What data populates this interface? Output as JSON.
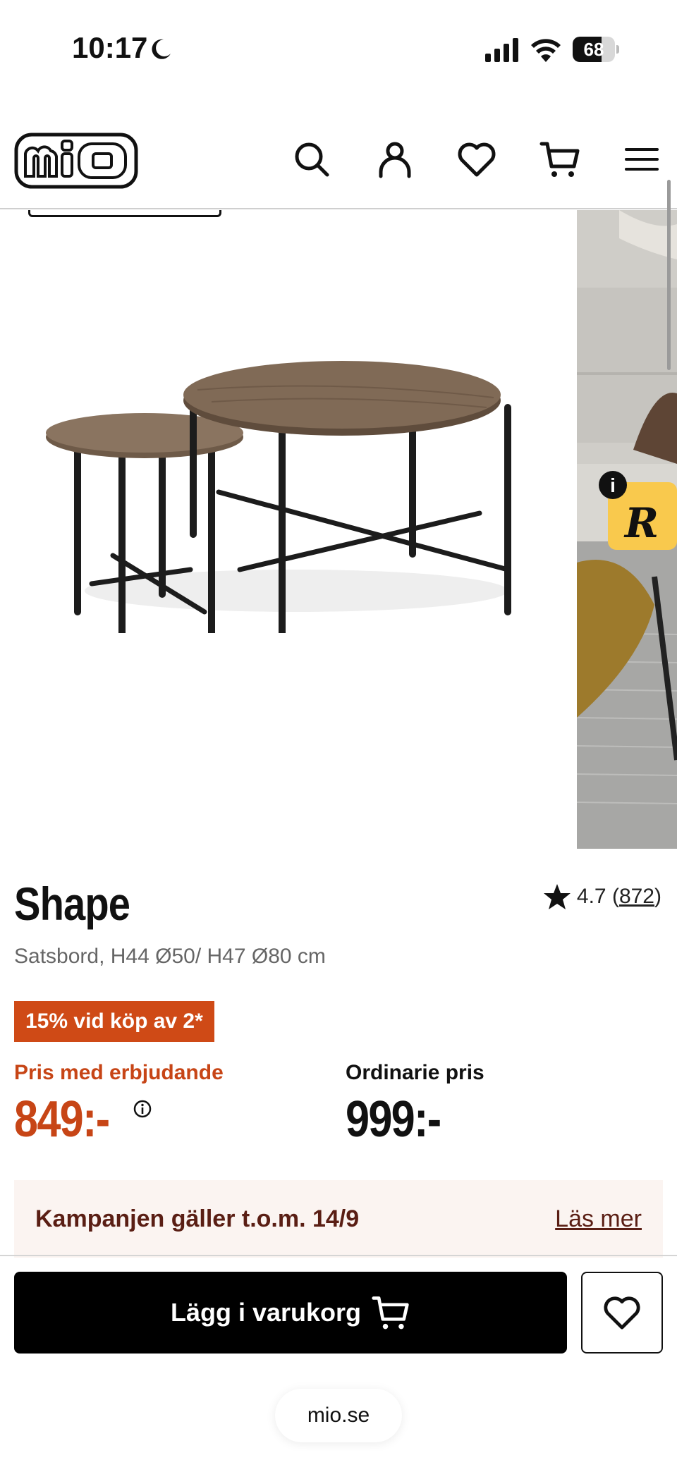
{
  "status_bar": {
    "time": "10:17",
    "battery_level": "68",
    "battery_fraction": 0.68
  },
  "header": {
    "logo_text": "mio",
    "icons": [
      "search-icon",
      "account-icon",
      "heart-icon",
      "cart-icon",
      "menu-icon"
    ]
  },
  "product": {
    "title": "Shape",
    "rating_value": "4.7",
    "rating_count": "872",
    "subtitle": "Satsbord, H44 Ø50/ H47 Ø80 cm",
    "promo_badge": "15% vid köp av 2*",
    "offer_price_label": "Pris med erbjudande",
    "offer_price": "849:-",
    "regular_price_label": "Ordinarie pris",
    "regular_price": "999:-"
  },
  "campaign": {
    "text": "Kampanjen gäller t.o.m. 14/9",
    "link": "Läs mer"
  },
  "actions": {
    "add_to_cart_label": "Lägg i varukorg"
  },
  "browser": {
    "url": "mio.se"
  },
  "colors": {
    "accent_orange": "#c74516",
    "promo_badge_bg": "#cf4a16",
    "campaign_bg": "#fbf4f1",
    "campaign_text": "#5a1e14",
    "button_black": "#000000",
    "review_badge_yellow": "#f9c94d"
  }
}
